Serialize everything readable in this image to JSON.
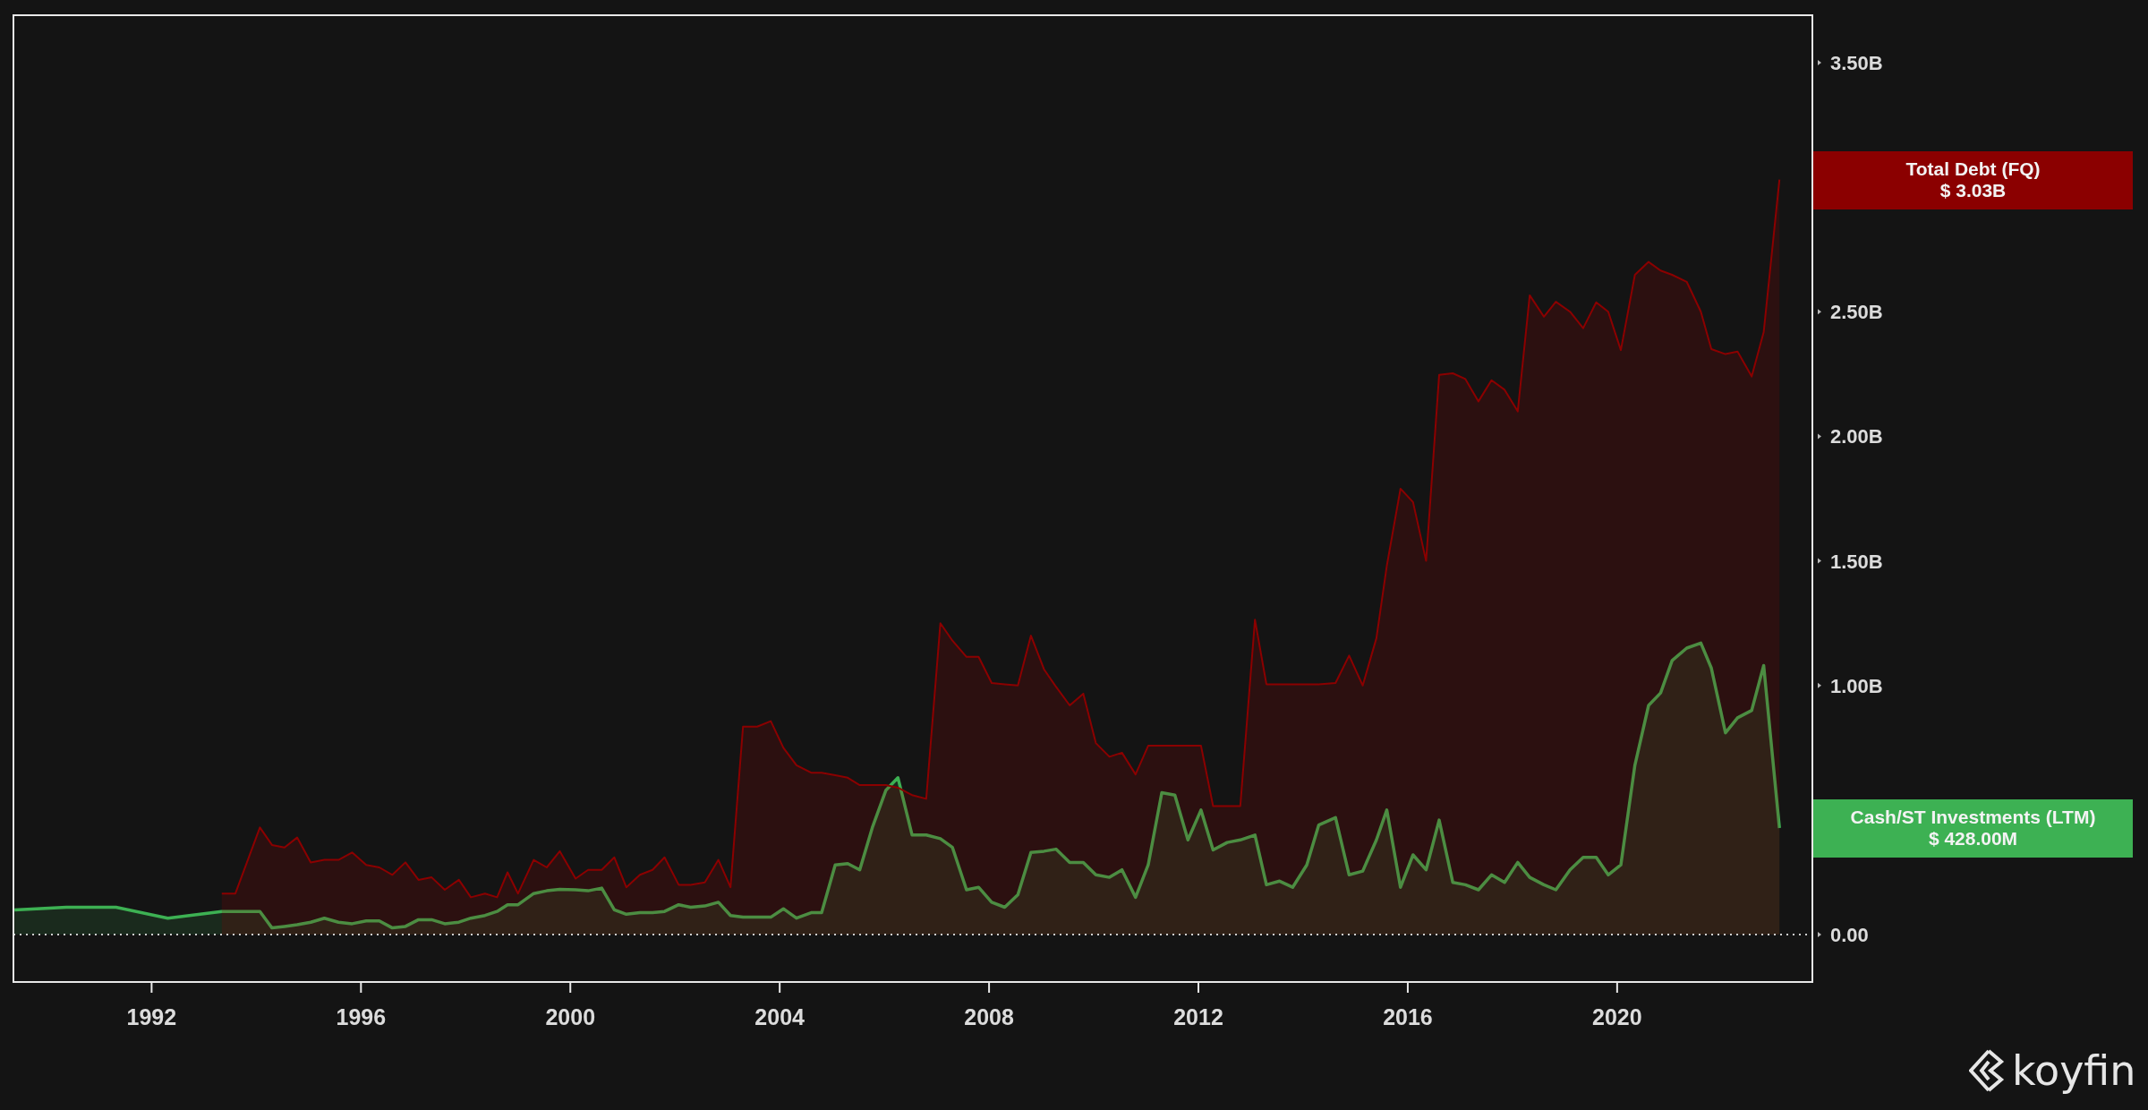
{
  "chart": {
    "chart_data": {
      "type": "area",
      "x": [
        1989.38,
        1990.37,
        1991.32,
        1992.31,
        1993.34,
        1993.6,
        1994.07,
        1994.3,
        1994.54,
        1994.78,
        1995.04,
        1995.3,
        1995.57,
        1995.83,
        1996.1,
        1996.35,
        1996.6,
        1996.85,
        1997.1,
        1997.35,
        1997.6,
        1997.87,
        1998.1,
        1998.37,
        1998.6,
        1998.8,
        1999.0,
        1999.3,
        1999.55,
        1999.8,
        2000.1,
        2000.34,
        2000.6,
        2000.84,
        2001.07,
        2001.33,
        2001.57,
        2001.8,
        2002.07,
        2002.3,
        2002.57,
        2002.83,
        2003.06,
        2003.3,
        2003.57,
        2003.83,
        2004.07,
        2004.32,
        2004.6,
        2004.8,
        2005.06,
        2005.3,
        2005.53,
        2005.77,
        2006.03,
        2006.26,
        2006.53,
        2006.8,
        2007.07,
        2007.3,
        2007.57,
        2007.8,
        2008.05,
        2008.3,
        2008.55,
        2008.8,
        2009.05,
        2009.28,
        2009.54,
        2009.8,
        2010.04,
        2010.3,
        2010.54,
        2010.8,
        2011.04,
        2011.3,
        2011.55,
        2011.8,
        2012.05,
        2012.28,
        2012.55,
        2012.8,
        2013.08,
        2013.3,
        2013.55,
        2013.8,
        2014.07,
        2014.3,
        2014.62,
        2014.88,
        2015.14,
        2015.4,
        2015.6,
        2015.86,
        2016.1,
        2016.35,
        2016.6,
        2016.86,
        2017.1,
        2017.35,
        2017.6,
        2017.85,
        2018.1,
        2018.33,
        2018.6,
        2018.83,
        2019.1,
        2019.35,
        2019.6,
        2019.83,
        2020.07,
        2020.34,
        2020.6,
        2020.83,
        2021.05,
        2021.33,
        2021.6,
        2021.8,
        2022.07,
        2022.3,
        2022.57,
        2022.8,
        2023.1
      ],
      "series": [
        {
          "name": "Cash/ST Investments (LTM)",
          "color": "#3db153",
          "values": [
            0.099,
            0.11,
            0.11,
            0.066,
            0.093,
            0.093,
            0.093,
            0.027,
            0.033,
            0.04,
            0.05,
            0.066,
            0.05,
            0.044,
            0.055,
            0.055,
            0.027,
            0.033,
            0.06,
            0.06,
            0.044,
            0.05,
            0.066,
            0.077,
            0.093,
            0.12,
            0.12,
            0.165,
            0.176,
            0.182,
            0.18,
            0.176,
            0.187,
            0.1,
            0.082,
            0.088,
            0.088,
            0.093,
            0.12,
            0.11,
            0.115,
            0.13,
            0.077,
            0.07,
            0.07,
            0.07,
            0.104,
            0.066,
            0.088,
            0.088,
            0.28,
            0.285,
            0.26,
            0.43,
            0.58,
            0.63,
            0.4,
            0.4,
            0.385,
            0.35,
            0.18,
            0.19,
            0.13,
            0.11,
            0.16,
            0.33,
            0.335,
            0.343,
            0.29,
            0.29,
            0.24,
            0.23,
            0.26,
            0.15,
            0.28,
            0.57,
            0.56,
            0.38,
            0.5,
            0.34,
            0.37,
            0.38,
            0.4,
            0.2,
            0.215,
            0.19,
            0.28,
            0.44,
            0.47,
            0.24,
            0.255,
            0.38,
            0.5,
            0.19,
            0.32,
            0.26,
            0.46,
            0.21,
            0.2,
            0.18,
            0.24,
            0.21,
            0.29,
            0.23,
            0.2,
            0.18,
            0.26,
            0.31,
            0.31,
            0.24,
            0.28,
            0.68,
            0.92,
            0.97,
            1.1,
            1.15,
            1.17,
            1.07,
            0.81,
            0.87,
            0.9,
            1.08,
            0.428
          ]
        },
        {
          "name": "Total Debt (FQ)",
          "color": "#8b0000",
          "values": [
            null,
            null,
            null,
            null,
            0.165,
            0.165,
            0.43,
            0.36,
            0.35,
            0.39,
            0.29,
            0.3,
            0.3,
            0.33,
            0.28,
            0.27,
            0.24,
            0.29,
            0.22,
            0.23,
            0.18,
            0.22,
            0.15,
            0.165,
            0.15,
            0.25,
            0.165,
            0.3,
            0.27,
            0.335,
            0.225,
            0.26,
            0.26,
            0.31,
            0.19,
            0.24,
            0.26,
            0.31,
            0.2,
            0.2,
            0.21,
            0.3,
            0.19,
            0.835,
            0.835,
            0.857,
            0.75,
            0.68,
            0.65,
            0.65,
            0.64,
            0.63,
            0.6,
            0.6,
            0.6,
            0.59,
            0.56,
            0.545,
            1.25,
            1.18,
            1.115,
            1.115,
            1.01,
            1.005,
            1.0,
            1.2,
            1.065,
            0.995,
            0.92,
            0.967,
            0.769,
            0.714,
            0.73,
            0.643,
            0.758,
            0.758,
            0.758,
            0.758,
            0.758,
            0.516,
            0.516,
            0.516,
            1.264,
            1.005,
            1.005,
            1.005,
            1.005,
            1.005,
            1.01,
            1.12,
            1.0,
            1.19,
            1.48,
            1.79,
            1.736,
            1.5,
            2.247,
            2.253,
            2.23,
            2.14,
            2.225,
            2.187,
            2.1,
            2.566,
            2.48,
            2.54,
            2.5,
            2.434,
            2.538,
            2.5,
            2.346,
            2.648,
            2.7,
            2.665,
            2.648,
            2.62,
            2.5,
            2.35,
            2.33,
            2.34,
            2.24,
            2.418,
            3.03
          ]
        }
      ],
      "xlim": [
        1989.36,
        2023.73
      ],
      "ylim": [
        -0.19,
        3.69
      ],
      "xticks": [
        1992,
        1996,
        2000,
        2004,
        2008,
        2012,
        2016,
        2020
      ],
      "yticks": [
        {
          "value": 0,
          "label": "0.00"
        },
        {
          "value": 1,
          "label": "1.00B"
        },
        {
          "value": 1.5,
          "label": "1.50B"
        },
        {
          "value": 2,
          "label": "2.00B"
        },
        {
          "value": 2.5,
          "label": "2.50B"
        },
        {
          "value": 3.5,
          "label": "3.50B"
        }
      ]
    },
    "value_badges": [
      {
        "value": "$ 3.03B"
      },
      {
        "value": "$ 428.00M"
      }
    ]
  },
  "brand": {
    "name": "koyfin"
  }
}
